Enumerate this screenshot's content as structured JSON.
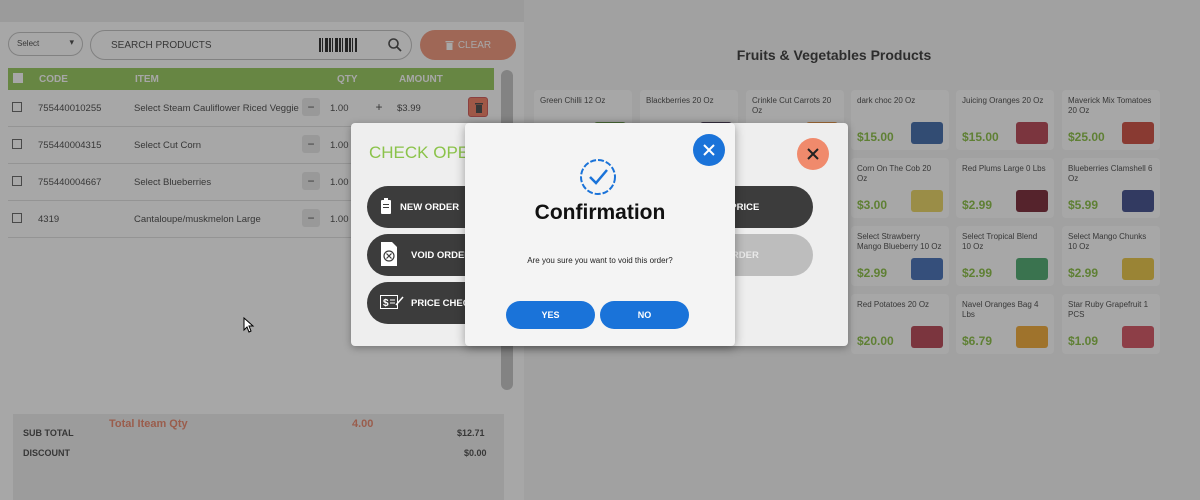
{
  "toolbar": {
    "select_value": "Select",
    "search_placeholder": "SEARCH PRODUCTS",
    "clear_label": "CLEAR"
  },
  "table": {
    "headers": {
      "code": "CODE",
      "item": "ITEM",
      "qty": "QTY",
      "amount": "AMOUNT"
    },
    "rows": [
      {
        "code": "755440010255",
        "item": "Select Steam Cauliflower Riced Veggie",
        "qty": "1.00",
        "amount": "$3.99"
      },
      {
        "code": "755440004315",
        "item": "Select Cut Corn",
        "qty": "1.00",
        "amount": ""
      },
      {
        "code": "755440004667",
        "item": "Select Blueberries",
        "qty": "1.00",
        "amount": ""
      },
      {
        "code": "4319",
        "item": "Cantaloupe/muskmelon Large",
        "qty": "1.00",
        "amount": ""
      }
    ]
  },
  "totals": {
    "subtotal_label": "SUB TOTAL",
    "subtotal_value": "$12.71",
    "discount_label": "DISCOUNT",
    "discount_value": "$0.00",
    "total_qty_label": "Total Iteam Qty",
    "total_qty_value": "4.00"
  },
  "products": {
    "title": "Fruits & Vegetables Products",
    "items": [
      {
        "name": "Green Chilli 12 Oz",
        "price": "",
        "thumb": "#5a9a3a"
      },
      {
        "name": "Blackberries 20 Oz",
        "price": "",
        "thumb": "#3a2a4a"
      },
      {
        "name": "Crinkle Cut Carrots 20 Oz",
        "price": "",
        "thumb": "#e88a30"
      },
      {
        "name": "dark choc 20 Oz",
        "price": "$15.00",
        "thumb": "#2a5aa0"
      },
      {
        "name": "Juicing Oranges 20 Oz",
        "price": "$15.00",
        "thumb": "#b03040"
      },
      {
        "name": "Maverick Mix Tomatoes 20 Oz",
        "price": "$25.00",
        "thumb": "#c83a2a"
      },
      {
        "name": "Corn On The Cob 20 Oz",
        "price": "$3.00",
        "thumb": "#e8d050"
      },
      {
        "name": "Red Plums Large 0 Lbs",
        "price": "$2.99",
        "thumb": "#6a1020"
      },
      {
        "name": "Blueberries Clamshell 6 Oz",
        "price": "$5.99",
        "thumb": "#2a3a80"
      },
      {
        "name": "Select Strawberry Mango Blueberry 10 Oz",
        "price": "$2.99",
        "thumb": "#3060b0"
      },
      {
        "name": "Select Tropical Blend 10 Oz",
        "price": "$2.99",
        "thumb": "#3aa060"
      },
      {
        "name": "Select Mango Chunks 10 Oz",
        "price": "$2.99",
        "thumb": "#e8c030"
      },
      {
        "name": "Red Potatoes 20 Oz",
        "price": "$20.00",
        "thumb": "#b03040"
      },
      {
        "name": "Navel Oranges Bag 4 Lbs",
        "price": "$6.79",
        "thumb": "#f0a020"
      },
      {
        "name": "Star Ruby Grapefruit 1 PCS",
        "price": "$1.09",
        "thumb": "#d04050"
      }
    ]
  },
  "options_modal": {
    "title": "CHECK OPE",
    "new_order": "NEW ORDER",
    "void_order": "VOID ORDER",
    "price_check": "PRICE CHEC",
    "right_top": "SE PRICE",
    "right_mid": "N ORDER"
  },
  "confirm": {
    "title": "Confirmation",
    "message": "Are you sure you want to void this order?",
    "yes": "YES",
    "no": "NO"
  },
  "colors": {
    "accent_green": "#8bc34a",
    "accent_blue": "#1a73d9",
    "clear_orange": "#f08a6c"
  }
}
